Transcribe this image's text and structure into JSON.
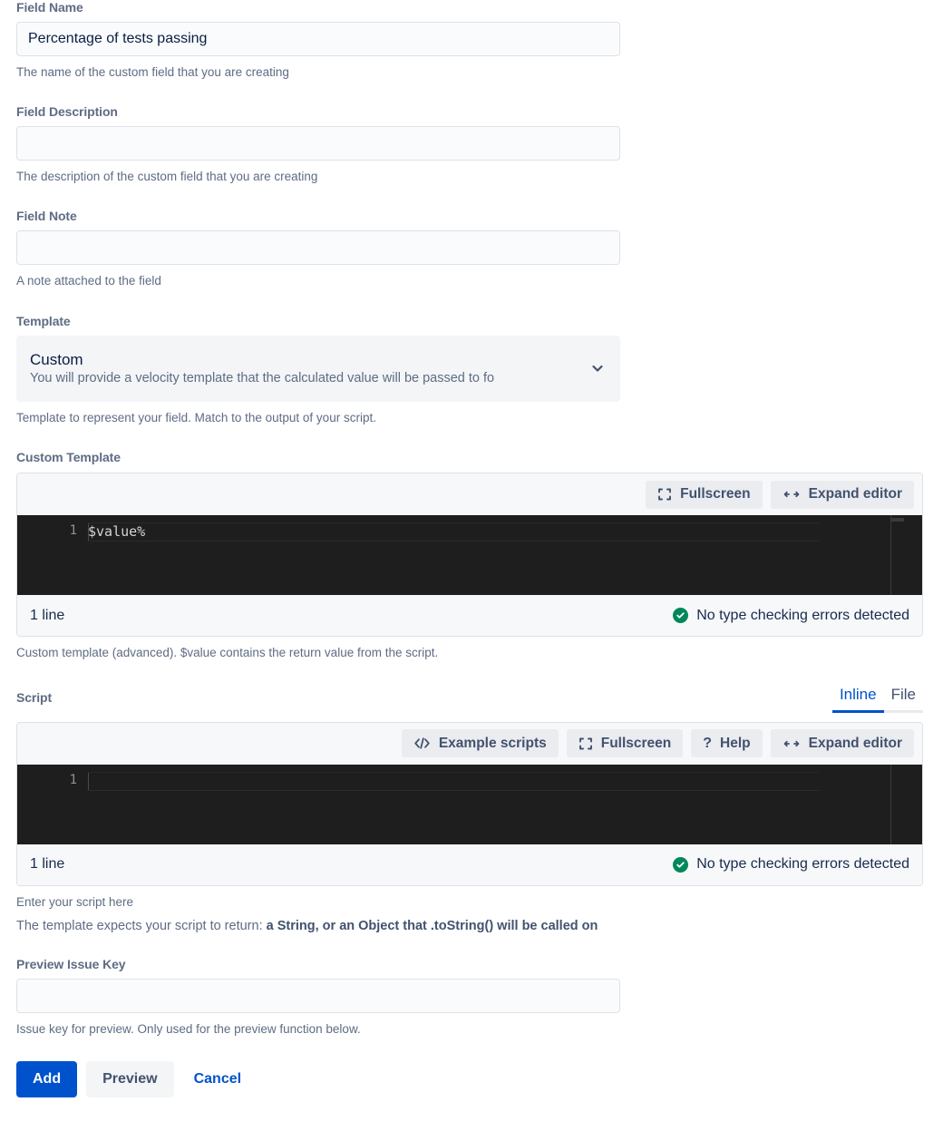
{
  "fields": {
    "field_name": {
      "label": "Field Name",
      "value": "Percentage of tests passing",
      "placeholder": "",
      "help": "The name of the custom field that you are creating"
    },
    "field_description": {
      "label": "Field Description",
      "value": "",
      "placeholder": "",
      "help": "The description of the custom field that you are creating"
    },
    "field_note": {
      "label": "Field Note",
      "value": "",
      "placeholder": "",
      "help": "A note attached to the field"
    },
    "preview_issue_key": {
      "label": "Preview Issue Key",
      "value": "",
      "placeholder": "",
      "help": "Issue key for preview. Only used for the preview function below."
    }
  },
  "template_select": {
    "label": "Template",
    "selected_title": "Custom",
    "selected_description": "You will provide a velocity template that the calculated value will be passed to fo",
    "chevron_icon": "chevron-down-icon",
    "help": "Template to represent your field. Match to the output of your script."
  },
  "custom_template": {
    "label": "Custom Template",
    "toolbar": [
      {
        "label": "Fullscreen",
        "icon": "fullscreen-icon"
      },
      {
        "label": "Expand editor",
        "icon": "expand-horizontal-icon"
      }
    ],
    "code": "$value%",
    "line_number": "1",
    "status_left": "1 line",
    "status_right": "No type checking errors detected",
    "status_icon": "check-circle-icon",
    "help": "Custom template (advanced). $value contains the return value from the script."
  },
  "script": {
    "label": "Script",
    "tabs": [
      {
        "label": "Inline",
        "active": true
      },
      {
        "label": "File",
        "active": false
      }
    ],
    "toolbar": [
      {
        "label": "Example scripts",
        "icon": "code-brackets-icon"
      },
      {
        "label": "Fullscreen",
        "icon": "fullscreen-icon"
      },
      {
        "label": "Help",
        "icon": "question-mark-icon"
      },
      {
        "label": "Expand editor",
        "icon": "expand-horizontal-icon"
      }
    ],
    "code": "",
    "line_number": "1",
    "status_left": "1 line",
    "status_right": "No type checking errors detected",
    "status_icon": "check-circle-icon",
    "help": "Enter your script here",
    "return_prefix": "The template expects your script to return: ",
    "return_value": "a String, or an Object that .toString() will be called on"
  },
  "actions": {
    "add_label": "Add",
    "preview_label": "Preview",
    "cancel_label": "Cancel"
  },
  "colors": {
    "accent": "#0052cc",
    "label": "#5e6c84",
    "success": "#00875a",
    "editor_bg": "#1e1e1e"
  }
}
